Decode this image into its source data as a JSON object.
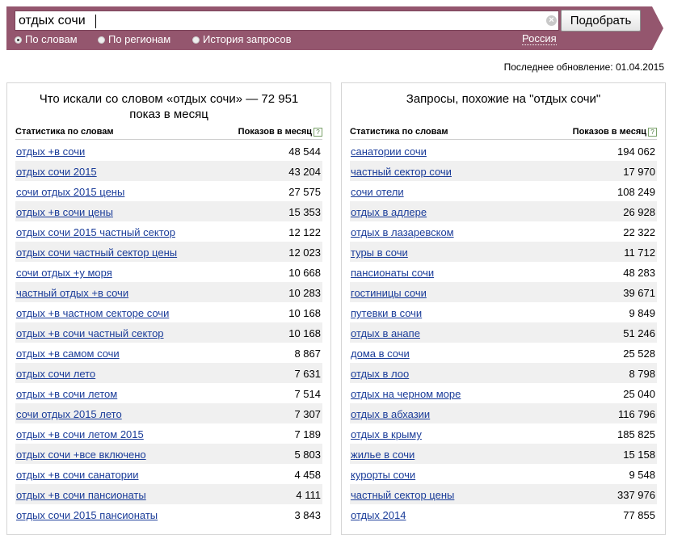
{
  "search": {
    "query": "отдых сочи",
    "submit_label": "Подобрать",
    "clear_symbol": "×"
  },
  "modes": [
    {
      "label": "По словам",
      "selected": true
    },
    {
      "label": "По регионам",
      "selected": false
    },
    {
      "label": "История запросов",
      "selected": false
    }
  ],
  "region": "Россия",
  "updated_label": "Последнее обновление: 01.04.2015",
  "colors": {
    "topbar": "#94566e",
    "link": "#1a3c99",
    "row_alt": "#f0f0f0"
  },
  "left_panel": {
    "title": "Что искали со словом «отдых сочи» — 72 951 показ в месяц",
    "col_phrase": "Статистика по словам",
    "col_count": "Показов в месяц",
    "help_icon": "?",
    "rows": [
      {
        "phrase": "отдых +в сочи",
        "count": "48 544"
      },
      {
        "phrase": "отдых сочи 2015",
        "count": "43 204"
      },
      {
        "phrase": "сочи отдых 2015 цены",
        "count": "27 575"
      },
      {
        "phrase": "отдых +в сочи цены",
        "count": "15 353"
      },
      {
        "phrase": "отдых сочи 2015 частный сектор",
        "count": "12 122"
      },
      {
        "phrase": "отдых сочи частный сектор цены",
        "count": "12 023"
      },
      {
        "phrase": "сочи отдых +у моря",
        "count": "10 668"
      },
      {
        "phrase": "частный отдых +в сочи",
        "count": "10 283"
      },
      {
        "phrase": "отдых +в частном секторе сочи",
        "count": "10 168"
      },
      {
        "phrase": "отдых +в сочи частный сектор",
        "count": "10 168"
      },
      {
        "phrase": "отдых +в самом сочи",
        "count": "8 867"
      },
      {
        "phrase": "отдых сочи лето",
        "count": "7 631"
      },
      {
        "phrase": "отдых +в сочи летом",
        "count": "7 514"
      },
      {
        "phrase": "сочи отдых 2015 лето",
        "count": "7 307"
      },
      {
        "phrase": "отдых +в сочи летом 2015",
        "count": "7 189"
      },
      {
        "phrase": "отдых сочи +все включено",
        "count": "5 803"
      },
      {
        "phrase": "отдых +в сочи санатории",
        "count": "4 458"
      },
      {
        "phrase": "отдых +в сочи пансионаты",
        "count": "4 111"
      },
      {
        "phrase": "отдых сочи 2015 пансионаты",
        "count": "3 843"
      }
    ]
  },
  "right_panel": {
    "title": "Запросы, похожие на \"отдых сочи\"",
    "col_phrase": "Статистика по словам",
    "col_count": "Показов в месяц",
    "help_icon": "?",
    "rows": [
      {
        "phrase": "санатории сочи",
        "count": "194 062"
      },
      {
        "phrase": "частный сектор сочи",
        "count": "17 970"
      },
      {
        "phrase": "сочи отели",
        "count": "108 249"
      },
      {
        "phrase": "отдых в адлере",
        "count": "26 928"
      },
      {
        "phrase": "отдых в лазаревском",
        "count": "22 322"
      },
      {
        "phrase": "туры в сочи",
        "count": "11 712"
      },
      {
        "phrase": "пансионаты сочи",
        "count": "48 283"
      },
      {
        "phrase": "гостиницы сочи",
        "count": "39 671"
      },
      {
        "phrase": "путевки в сочи",
        "count": "9 849"
      },
      {
        "phrase": "отдых в анапе",
        "count": "51 246"
      },
      {
        "phrase": "дома в сочи",
        "count": "25 528"
      },
      {
        "phrase": "отдых в лоо",
        "count": "8 798"
      },
      {
        "phrase": "отдых на черном море",
        "count": "25 040"
      },
      {
        "phrase": "отдых в абхазии",
        "count": "116 796"
      },
      {
        "phrase": "отдых в крыму",
        "count": "185 825"
      },
      {
        "phrase": "жилье в сочи",
        "count": "15 158"
      },
      {
        "phrase": "курорты сочи",
        "count": "9 548"
      },
      {
        "phrase": "частный сектор цены",
        "count": "337 976"
      },
      {
        "phrase": "отдых 2014",
        "count": "77 855"
      }
    ]
  }
}
